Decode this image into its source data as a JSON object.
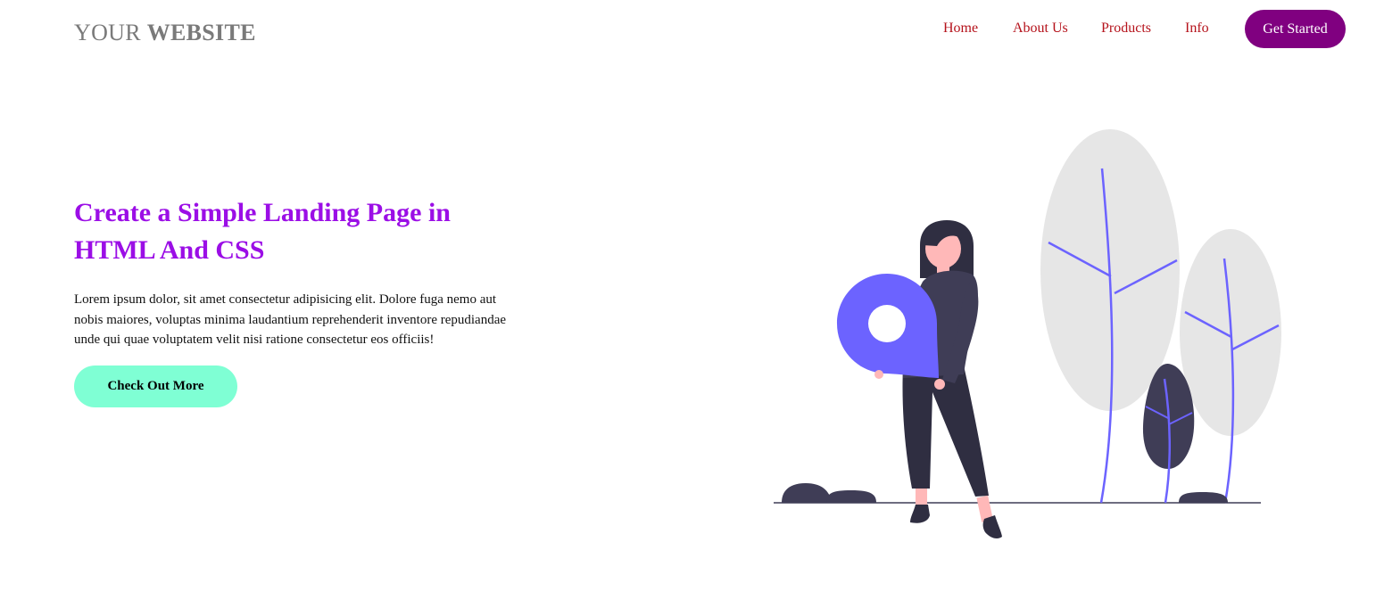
{
  "header": {
    "logo": {
      "light": "YOUR",
      "bold": "WEBSITE"
    },
    "nav": [
      "Home",
      "About Us",
      "Products",
      "Info"
    ],
    "cta_label": "Get Started"
  },
  "hero": {
    "title": "Create a Simple Landing Page in HTML And CSS",
    "body": "Lorem ipsum dolor, sit amet consectetur adipisicing elit. Dolore fuga nemo aut nobis maiores, voluptas minima laudantium reprehenderit inventore repudiandae unde qui quae voluptatem velit nisi ratione consectetur eos officiis!",
    "button_label": "Check Out More"
  },
  "colors": {
    "logo": "#7a7a7a",
    "nav_link": "#b5121b",
    "cta_bg": "#800080",
    "title": "#9b0ee6",
    "hero_button_bg": "#7fffd4",
    "illustration_accent": "#6c63ff",
    "illustration_dark": "#3f3d56",
    "illustration_tree": "#e6e6e6"
  },
  "illustration": {
    "icons": [
      "woman-figure-icon",
      "location-pin-icon",
      "tree-icon",
      "bush-icon",
      "rock-icon"
    ]
  }
}
